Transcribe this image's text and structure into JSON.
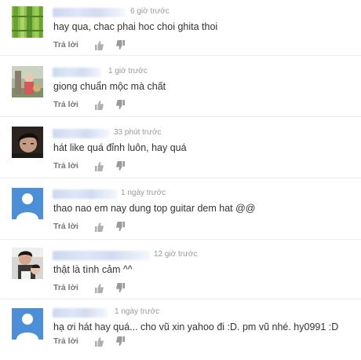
{
  "comments": [
    {
      "time": "6 giờ trước",
      "text": "hay qua, chac phai hoc choi ghita thoi",
      "reply": "Trả lời",
      "avatar": "bamboo-avatar"
    },
    {
      "time": "1 giờ trước",
      "text": "giong chuẩn mộc mà chất",
      "reply": "Trả lời",
      "avatar": "photo-avatar"
    },
    {
      "time": "33 phút trước",
      "text": "hát like quá đỉnh luôn, hay quá",
      "reply": "Trả lời",
      "avatar": "photo-avatar"
    },
    {
      "time": "1 ngày trước",
      "text": "thao nao em nay dung top guitar dem hat @@",
      "reply": "Trả lời",
      "avatar": "default-avatar"
    },
    {
      "time": "12 giờ trước",
      "text": "thật là tình cảm ^^",
      "reply": "Trả lời",
      "avatar": "photo-avatar"
    },
    {
      "time": "1 ngày trước",
      "text": "hạ ơi hát hay quá... cho vũ xin yahoo đi :D. pm vũ nhé. hy0991 :D",
      "reply": "Trả lời",
      "avatar": "default-avatar"
    }
  ],
  "colors": {
    "default_avatar_bg": "#4d8fd6",
    "text": "#333333",
    "meta": "#9a9a9a",
    "icon": "#b0b0b0"
  }
}
